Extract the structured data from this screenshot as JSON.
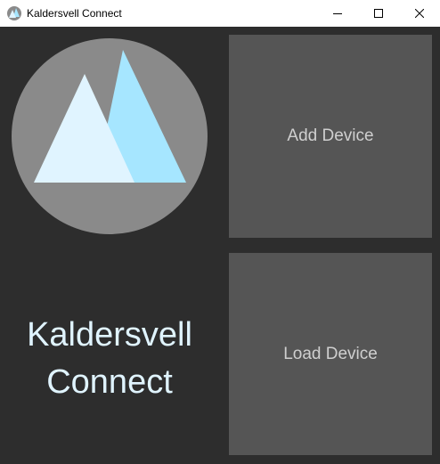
{
  "window": {
    "title": "Kaldersvell Connect",
    "controls": {
      "minimize_icon": "minimize-icon",
      "maximize_icon": "maximize-icon",
      "close_icon": "close-icon"
    }
  },
  "branding": {
    "name_line1": "Kaldersvell",
    "name_line2": "Connect",
    "logo_icon": "mountain-logo-icon"
  },
  "actions": {
    "add_device_label": "Add Device",
    "load_device_label": "Load Device"
  },
  "colors": {
    "background": "#2d2d2d",
    "tile": "#555555",
    "tile_text": "#cfcfcf",
    "logo_circle": "#8a8a8a",
    "logo_peak_back": "#a6e6ff",
    "logo_peak_front": "#e0f4ff",
    "name_text": "#e0f4ff"
  }
}
